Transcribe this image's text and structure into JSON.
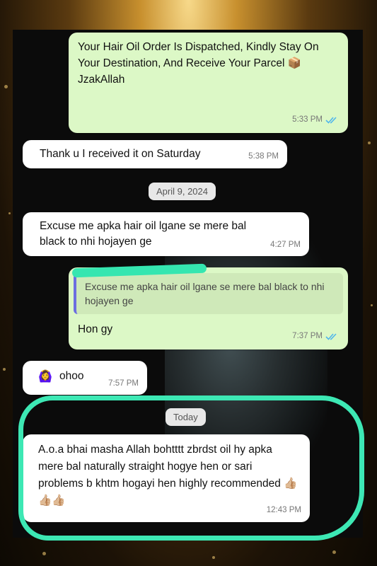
{
  "messages": {
    "m1": {
      "text": "Your Hair Oil Order Is Dispatched, Kindly Stay On Your Destination, And Receive Your Parcel 📦 JzakAllah",
      "time": "5:33 PM"
    },
    "m2": {
      "text": "Thank u I received it on Saturday",
      "time": "5:38 PM"
    },
    "date1": "April 9, 2024",
    "m3": {
      "text": "Excuse me apka hair oil lgane se mere bal black to nhi hojayen ge",
      "time": "4:27 PM"
    },
    "m4": {
      "quote_text": "Excuse me apka hair oil lgane se mere bal black to nhi hojayen ge",
      "text": "Hon gy",
      "time": "7:37 PM"
    },
    "m5": {
      "emoji": "🙆‍♀️",
      "text": "ohoo",
      "time": "7:57 PM"
    },
    "date2": "Today",
    "m6": {
      "text": "A.o.a bhai masha Allah bohtttt zbrdst oil hy apka mere bal naturally straight hogye hen or sari problems b khtm hogayi hen highly recommended 👍🏼👍🏼👍🏼",
      "time": "12:43 PM"
    }
  },
  "colors": {
    "outgoing_bubble": "#dcf8c6",
    "incoming_bubble": "#ffffff",
    "read_ticks": "#4fb6ec",
    "highlight_marker": "#3de8b4"
  },
  "icons": [
    "double-check-read-icon"
  ]
}
